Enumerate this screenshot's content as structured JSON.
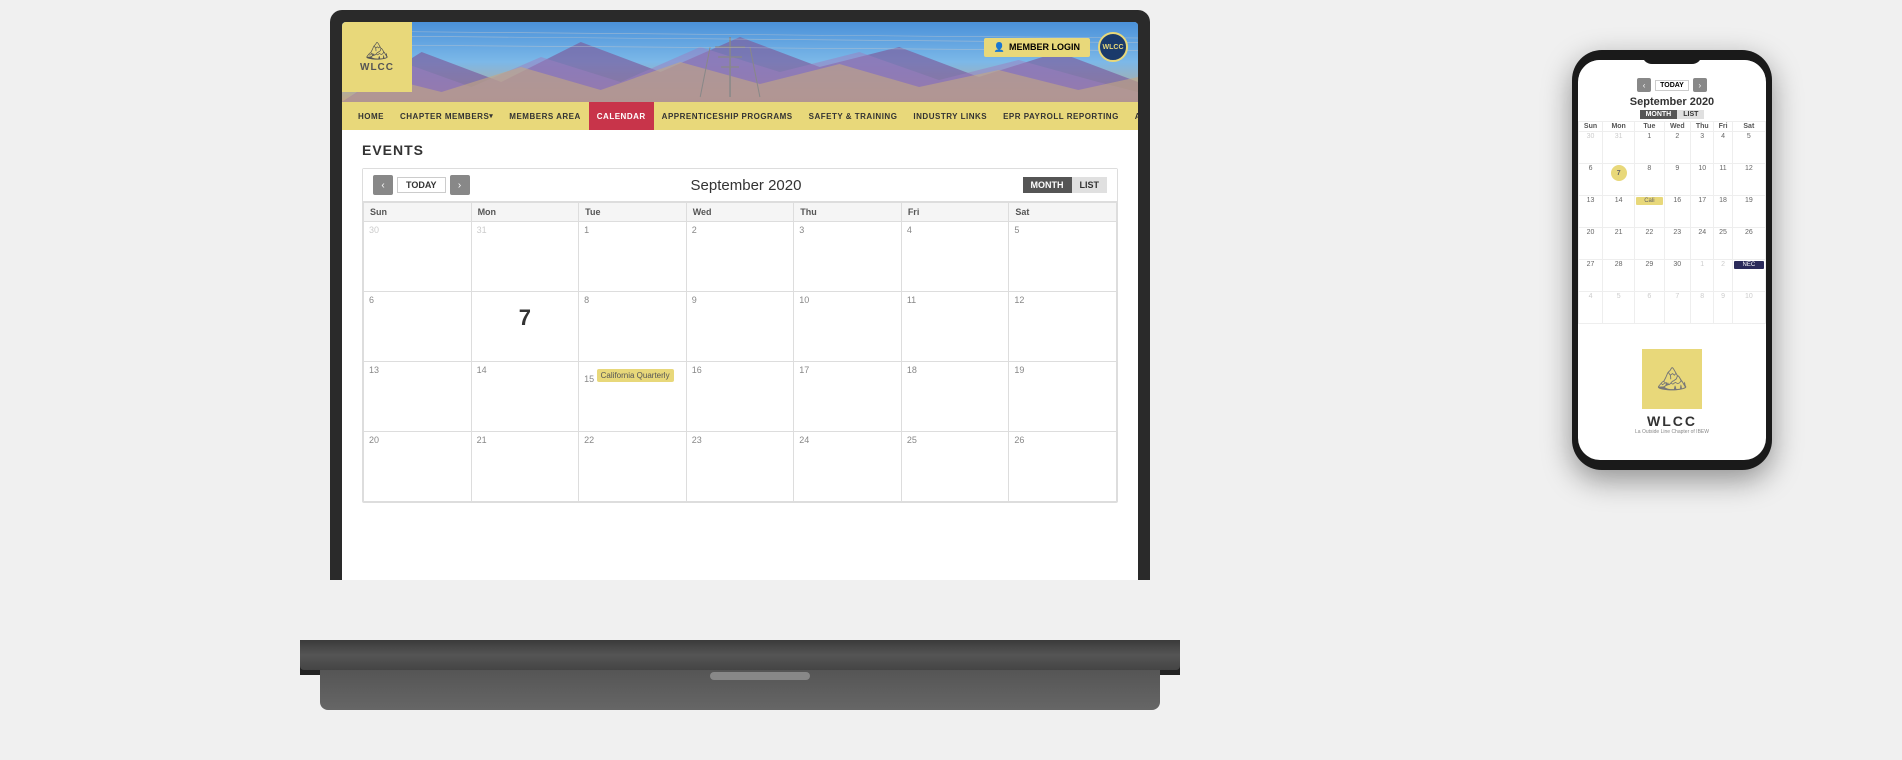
{
  "laptop": {
    "header": {
      "logo_text": "WLCC",
      "member_login": "MEMBER LOGIN",
      "badge_text": "WLCC"
    },
    "nav": {
      "items": [
        {
          "label": "HOME",
          "active": false,
          "has_arrow": false
        },
        {
          "label": "CHAPTER MEMBERS",
          "active": false,
          "has_arrow": true
        },
        {
          "label": "MEMBERS AREA",
          "active": false,
          "has_arrow": false
        },
        {
          "label": "CALENDAR",
          "active": true,
          "has_arrow": false
        },
        {
          "label": "APPRENTICESHIP PROGRAMS",
          "active": false,
          "has_arrow": false
        },
        {
          "label": "SAFETY & TRAINING",
          "active": false,
          "has_arrow": false
        },
        {
          "label": "INDUSTRY LINKS",
          "active": false,
          "has_arrow": false
        },
        {
          "label": "EPR PAYROLL REPORTING",
          "active": false,
          "has_arrow": false
        },
        {
          "label": "ABOUT US",
          "active": false,
          "has_arrow": true
        }
      ]
    },
    "content": {
      "events_title": "EVENTS",
      "calendar": {
        "title": "September 2020",
        "today_label": "TODAY",
        "month_btn": "MONTH",
        "list_btn": "LIST",
        "days": [
          "Sun",
          "Mon",
          "Tue",
          "Wed",
          "Thu",
          "Fri",
          "Sat"
        ],
        "rows": [
          [
            {
              "num": "30",
              "dim": true,
              "events": []
            },
            {
              "num": "31",
              "dim": true,
              "events": []
            },
            {
              "num": "1",
              "dim": false,
              "events": []
            },
            {
              "num": "2",
              "dim": false,
              "events": []
            },
            {
              "num": "3",
              "dim": false,
              "events": []
            },
            {
              "num": "4",
              "dim": false,
              "events": []
            },
            {
              "num": "5",
              "dim": false,
              "events": []
            }
          ],
          [
            {
              "num": "6",
              "dim": false,
              "events": []
            },
            {
              "num": "7",
              "dim": false,
              "today": true,
              "events": []
            },
            {
              "num": "8",
              "dim": false,
              "events": []
            },
            {
              "num": "9",
              "dim": false,
              "events": []
            },
            {
              "num": "10",
              "dim": false,
              "events": []
            },
            {
              "num": "11",
              "dim": false,
              "events": []
            },
            {
              "num": "12",
              "dim": false,
              "events": []
            }
          ],
          [
            {
              "num": "13",
              "dim": false,
              "events": []
            },
            {
              "num": "14",
              "dim": false,
              "events": []
            },
            {
              "num": "15",
              "dim": false,
              "events": [
                "California Quarterly"
              ]
            },
            {
              "num": "16",
              "dim": false,
              "events": []
            },
            {
              "num": "17",
              "dim": false,
              "events": []
            },
            {
              "num": "18",
              "dim": false,
              "events": []
            },
            {
              "num": "19",
              "dim": false,
              "events": []
            }
          ],
          [
            {
              "num": "20",
              "dim": false,
              "events": []
            },
            {
              "num": "21",
              "dim": false,
              "events": []
            },
            {
              "num": "22",
              "dim": false,
              "events": []
            },
            {
              "num": "23",
              "dim": false,
              "events": []
            },
            {
              "num": "24",
              "dim": false,
              "events": []
            },
            {
              "num": "25",
              "dim": false,
              "events": []
            },
            {
              "num": "26",
              "dim": false,
              "events": []
            }
          ]
        ]
      }
    }
  },
  "phone": {
    "calendar": {
      "title": "September 2020",
      "today_label": "TODAY",
      "month_btn": "MONTH",
      "list_btn": "LIST",
      "days": [
        "Sun",
        "Mon",
        "Tue",
        "Wed",
        "Thu",
        "Fri",
        "Sat"
      ],
      "rows": [
        [
          "30",
          "31",
          "1",
          "2",
          "3",
          "4",
          "5"
        ],
        [
          "6",
          "7",
          "8",
          "9",
          "10",
          "11",
          "12"
        ],
        [
          "20",
          "21",
          "22",
          "23",
          "24",
          "25",
          "26"
        ],
        [
          "27",
          "28",
          "29",
          "30",
          "1",
          "2",
          "3"
        ],
        [
          "4",
          "5",
          "6",
          "7",
          "8",
          "9",
          "10"
        ]
      ],
      "event_cell": {
        "row": 2,
        "col": 2,
        "label": "Cali"
      },
      "event2_cell": {
        "row": 3,
        "col": 6,
        "label": "NEC"
      }
    },
    "logo": {
      "text": "WLCC",
      "sub": "La Outside Line Chapter of IBEW"
    }
  }
}
